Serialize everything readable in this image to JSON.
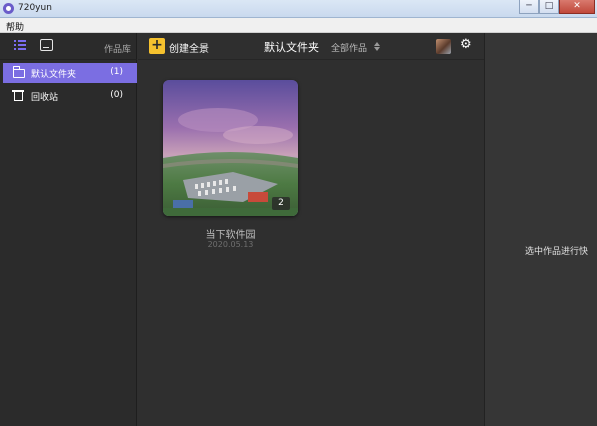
{
  "window": {
    "title": "720yun",
    "minimize": "─",
    "maximize": "□",
    "close": "✕"
  },
  "menu": {
    "help": "帮助"
  },
  "sidebar": {
    "library_label": "作品库",
    "items": [
      {
        "label": "默认文件夹",
        "count": "(1)",
        "icon": "folder-icon",
        "active": true
      },
      {
        "label": "回收站",
        "count": "(0)",
        "icon": "trash-icon",
        "active": false
      }
    ]
  },
  "toolbar": {
    "create_label": "创建全景",
    "create_plus": "+",
    "folder_title": "默认文件夹",
    "filter_label": "全部作品",
    "settings_glyph": "⚙"
  },
  "works": [
    {
      "name": "当下软件园",
      "date": "2020.05.13",
      "scene_count": "2"
    }
  ],
  "right_panel": {
    "hint": "选中作品进行快"
  },
  "colors": {
    "accent": "#7b6ee2",
    "create_button": "#f5c12e",
    "background": "#2f2f2f"
  }
}
